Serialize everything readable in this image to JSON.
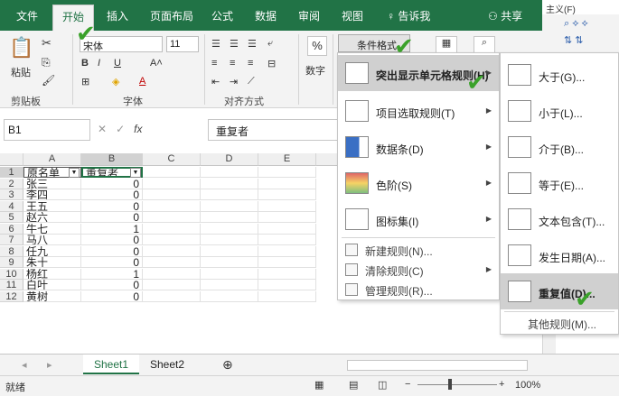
{
  "ribbon": {
    "tabs": [
      "文件",
      "开始",
      "插入",
      "页面布局",
      "公式",
      "数据",
      "审阅",
      "视图"
    ],
    "tell_me": "告诉我",
    "share": "共享",
    "paste_label": "粘贴",
    "clipboard_label": "剪贴板",
    "font_label": "字体",
    "align_label": "对齐方式",
    "number_label": "数字",
    "percent_symbol": "%",
    "font_name": "宋体",
    "font_size": "11",
    "cond_format_label": "条件格式"
  },
  "formula_bar": {
    "name_box": "B1",
    "fx": "fx",
    "content": "重复者"
  },
  "grid": {
    "columns": [
      "A",
      "B",
      "C",
      "D",
      "E"
    ],
    "rows": [
      {
        "n": "1",
        "a": "原名单",
        "b": "重复者"
      },
      {
        "n": "2",
        "a": "张三",
        "b": "0"
      },
      {
        "n": "3",
        "a": "李四",
        "b": "0"
      },
      {
        "n": "4",
        "a": "王五",
        "b": "0"
      },
      {
        "n": "5",
        "a": "赵六",
        "b": "0"
      },
      {
        "n": "6",
        "a": "牛七",
        "b": "1"
      },
      {
        "n": "7",
        "a": "马八",
        "b": "0"
      },
      {
        "n": "8",
        "a": "任九",
        "b": "0"
      },
      {
        "n": "9",
        "a": "朱十",
        "b": "0"
      },
      {
        "n": "10",
        "a": "杨红",
        "b": "1"
      },
      {
        "n": "11",
        "a": "白叶",
        "b": "0"
      },
      {
        "n": "12",
        "a": "黄树",
        "b": "0"
      }
    ]
  },
  "sheets": [
    "Sheet1",
    "Sheet2"
  ],
  "status": {
    "ready": "就绪",
    "zoom": "100%"
  },
  "menu1": {
    "items": [
      {
        "label": "突出显示单元格规则(H)"
      },
      {
        "label": "项目选取规则(T)"
      },
      {
        "label": "数据条(D)"
      },
      {
        "label": "色阶(S)"
      },
      {
        "label": "图标集(I)"
      },
      {
        "label": "新建规则(N)..."
      },
      {
        "label": "清除规则(C)"
      },
      {
        "label": "管理规则(R)..."
      }
    ]
  },
  "menu2": {
    "items": [
      {
        "label": "大于(G)..."
      },
      {
        "label": "小于(L)..."
      },
      {
        "label": "介于(B)..."
      },
      {
        "label": "等于(E)..."
      },
      {
        "label": "文本包含(T)..."
      },
      {
        "label": "发生日期(A)..."
      },
      {
        "label": "重复值(D)..."
      },
      {
        "label": "其他规则(M)..."
      }
    ]
  },
  "right_peek": "主义(F)"
}
